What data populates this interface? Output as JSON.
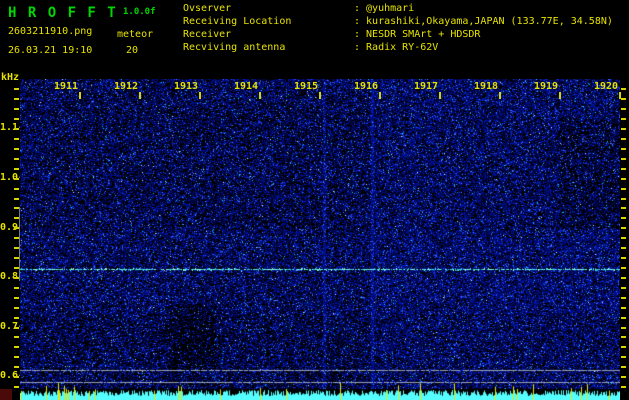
{
  "app": {
    "title": "H R O F F T",
    "version": "1.0.0f",
    "filename": "2603211910.png",
    "mode": "meteor",
    "count": "20",
    "datetime": "26.03.21 19:10"
  },
  "info": [
    {
      "label": "Ovserver",
      "value": "@yuhmari"
    },
    {
      "label": "Receiving Location",
      "value": "kurashiki,Okayama,JAPAN (133.77E, 34.58N)"
    },
    {
      "label": "Receiver",
      "value": "NESDR SMArt + HDSDR"
    },
    {
      "label": "Recviving antenna",
      "value": "Radix RY-62V"
    }
  ],
  "axes": {
    "y_unit": "kHz",
    "y_labels": [
      "1.1",
      "1.0",
      "0.9",
      "0.8",
      "0.7",
      "0.6"
    ],
    "x_labels": [
      "1911",
      "1912",
      "1913",
      "1914",
      "1915",
      "1916",
      "1917",
      "1918",
      "1919",
      "1920"
    ],
    "tick_color": "#d8d400"
  },
  "colors": {
    "background": "#000000",
    "text_yellow": "#e6e200",
    "text_green": "#00d600"
  },
  "spectrogram": {
    "seed": 20210326,
    "carrier_freq_khz": "0.82",
    "noise_colors": [
      "#000a78",
      "#0019b4",
      "#2245ee",
      "#4b7bff"
    ],
    "sparkle_cyan": "#00d2ff",
    "sparkle_white": "#cfe6ff",
    "carrier_colors": [
      "#44e8d8",
      "#7bfff0",
      "#a6ffe9",
      "#2fc8d8"
    ],
    "gray_line_color": "#aab2bc",
    "strip_color": "#55ffff",
    "spike_color": "#e8e600"
  }
}
